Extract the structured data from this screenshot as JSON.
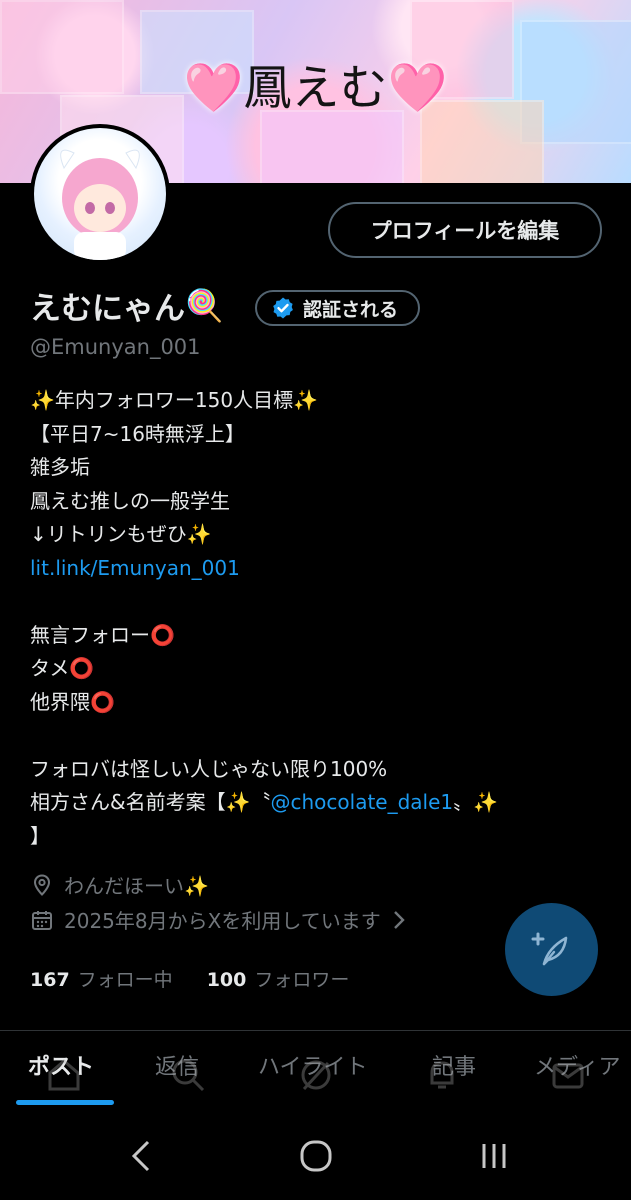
{
  "banner": {
    "title": "鳳えむ",
    "heart_left": "🩷",
    "heart_right": "🩷"
  },
  "profile": {
    "display_name": "えむにゃん",
    "name_emoji": "🍭",
    "verify_label": "認証される",
    "handle": "@Emunyan_001",
    "edit_button": "プロフィールを編集"
  },
  "bio": {
    "lines": [
      "✨年内フォロワー150人目標✨",
      "【平日7~16時無浮上】",
      "雑多垢",
      "鳳えむ推しの一般学生",
      "↓リトリンもぜひ✨",
      "",
      "",
      "無言フォロー⭕",
      "タメ⭕",
      "他界隈⭕",
      "",
      "フォロバは怪しい人じゃない限り100%",
      "",
      "】"
    ],
    "link": "lit.link/Emunyan_001",
    "line12_prefix": "相方さん&名前考案【✨〝",
    "mention": "@chocolate_dale1",
    "line12_suffix": "〟✨"
  },
  "meta": {
    "location": "わんだほーい✨",
    "joined": "2025年8月からXを利用しています",
    "location_icon": "location-pin-icon",
    "calendar_icon": "calendar-icon"
  },
  "counts": {
    "following_num": "167",
    "following_label": "フォロー中",
    "followers_num": "100",
    "followers_label": "フォロワー"
  },
  "tabs": [
    "ポスト",
    "返信",
    "ハイライト",
    "記事",
    "メディア"
  ],
  "colors": {
    "accent": "#1d9bf0",
    "background": "#000000",
    "muted": "#71767b"
  }
}
